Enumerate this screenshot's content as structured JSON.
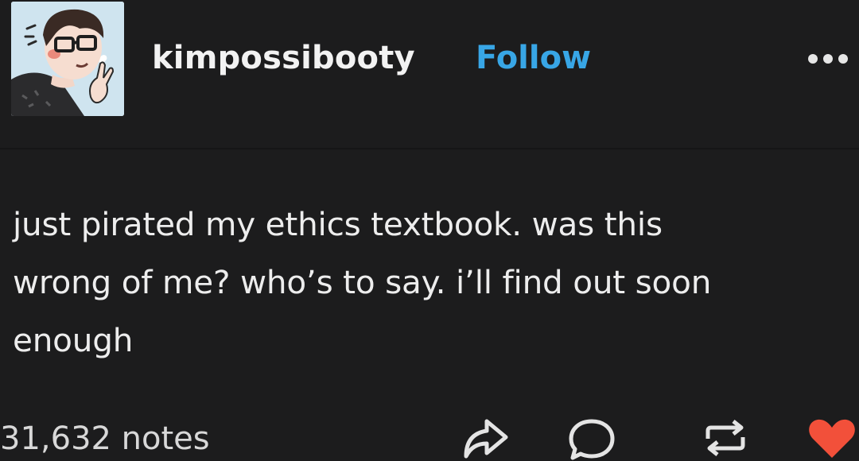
{
  "post": {
    "username": "kimpossibooty",
    "follow_label": "Follow",
    "more_icon": "ellipsis-icon",
    "body_lines": [
      "just pirated my ethics textbook. was this",
      "wrong of me? who’s to say. i’ll find out soon",
      "enough"
    ],
    "notes": "31,632 notes"
  },
  "actions": {
    "share_icon": "share-icon",
    "reply_icon": "reply-icon",
    "reblog_icon": "reblog-icon",
    "like_icon": "heart-icon"
  },
  "colors": {
    "background": "#1c1c1d",
    "text": "#ececec",
    "follow": "#38a6e6",
    "like": "#f2503a"
  }
}
